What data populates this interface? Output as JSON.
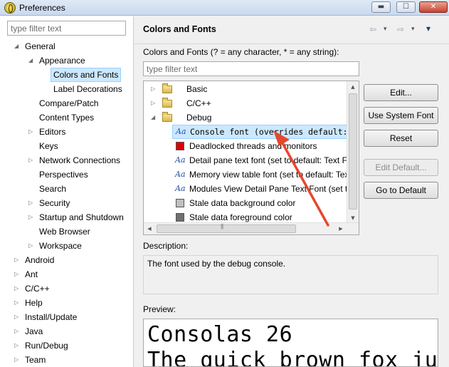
{
  "window": {
    "title": "Preferences",
    "controls": {
      "minimize": "▬",
      "maximize": "☐",
      "close": "✕"
    }
  },
  "left_tree": {
    "filter_placeholder": "type filter text",
    "items": [
      {
        "label": "General",
        "expand": "◢"
      },
      {
        "label": "Appearance",
        "expand": "◢"
      },
      {
        "label": "Colors and Fonts",
        "selected": true
      },
      {
        "label": "Label Decorations"
      },
      {
        "label": "Compare/Patch"
      },
      {
        "label": "Content Types"
      },
      {
        "label": "Editors",
        "expand": "▷"
      },
      {
        "label": "Keys"
      },
      {
        "label": "Network Connections",
        "expand": "▷"
      },
      {
        "label": "Perspectives"
      },
      {
        "label": "Search"
      },
      {
        "label": "Security",
        "expand": "▷"
      },
      {
        "label": "Startup and Shutdown",
        "expand": "▷"
      },
      {
        "label": "Web Browser"
      },
      {
        "label": "Workspace",
        "expand": "▷"
      },
      {
        "label": "Android",
        "expand": "▷"
      },
      {
        "label": "Ant",
        "expand": "▷"
      },
      {
        "label": "C/C++",
        "expand": "▷"
      },
      {
        "label": "Help",
        "expand": "▷"
      },
      {
        "label": "Install/Update",
        "expand": "▷"
      },
      {
        "label": "Java",
        "expand": "▷"
      },
      {
        "label": "Run/Debug",
        "expand": "▷"
      },
      {
        "label": "Team",
        "expand": "▷"
      }
    ]
  },
  "page": {
    "title": "Colors and Fonts",
    "nav": {
      "back": "⇦",
      "back_menu": "▾",
      "forward": "⇨",
      "forward_menu": "▾",
      "view_menu": "▾"
    },
    "filter_label": "Colors and Fonts (? = any character, * = any string):",
    "filter_placeholder": "type filter text",
    "colors_tree": {
      "rows": [
        {
          "label": "Basic",
          "expand": "▷"
        },
        {
          "label": "C/C++",
          "expand": "▷"
        },
        {
          "label": "Debug",
          "expand": "◢"
        },
        {
          "label": "Console font (overrides default: Text Font)",
          "icon": "Aa",
          "selected": true
        },
        {
          "label": "Deadlocked threads and monitors",
          "swatch": "#e00000"
        },
        {
          "label": "Detail pane text font (set to default: Text Font)",
          "icon": "Aa"
        },
        {
          "label": "Memory view table font (set to default: Text Font)",
          "icon": "Aa"
        },
        {
          "label": "Modules View Detail Pane Text Font (set to default: Text Font)",
          "icon": "Aa"
        },
        {
          "label": "Stale data background color",
          "swatch": "#c0c0c0"
        },
        {
          "label": "Stale data foreground color",
          "swatch": "#707070"
        }
      ],
      "scroll": {
        "up": "▲",
        "down": "▼",
        "left": "◀",
        "right": "▶"
      }
    },
    "buttons": {
      "edit": "Edit...",
      "use_system_font": "Use System Font",
      "reset": "Reset",
      "edit_default": "Edit Default...",
      "go_to_default": "Go to Default"
    },
    "description_label": "Description:",
    "description_text": "The font used by the debug console.",
    "preview_label": "Preview:",
    "preview_lines": [
      "Consolas 26",
      "The quick brown fox jumps over the lazy dog."
    ]
  },
  "colors": {
    "selection": "#cce8ff",
    "selection_border": "#99d1ff",
    "annotation_arrow": "#e8462e"
  }
}
